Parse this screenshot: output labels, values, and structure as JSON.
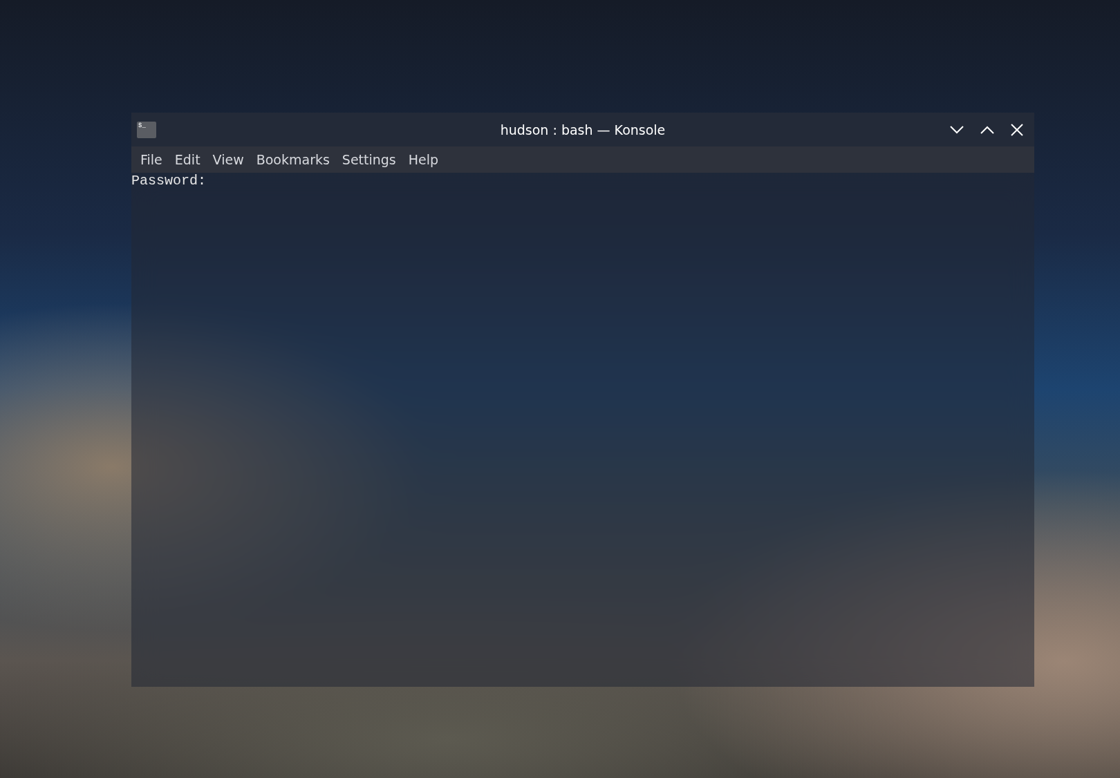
{
  "window": {
    "title": "hudson : bash — Konsole",
    "app_icon_text": "$_"
  },
  "menu": [
    "File",
    "Edit",
    "View",
    "Bookmarks",
    "Settings",
    "Help"
  ],
  "terminal": {
    "lines": [
      "Password:"
    ]
  }
}
